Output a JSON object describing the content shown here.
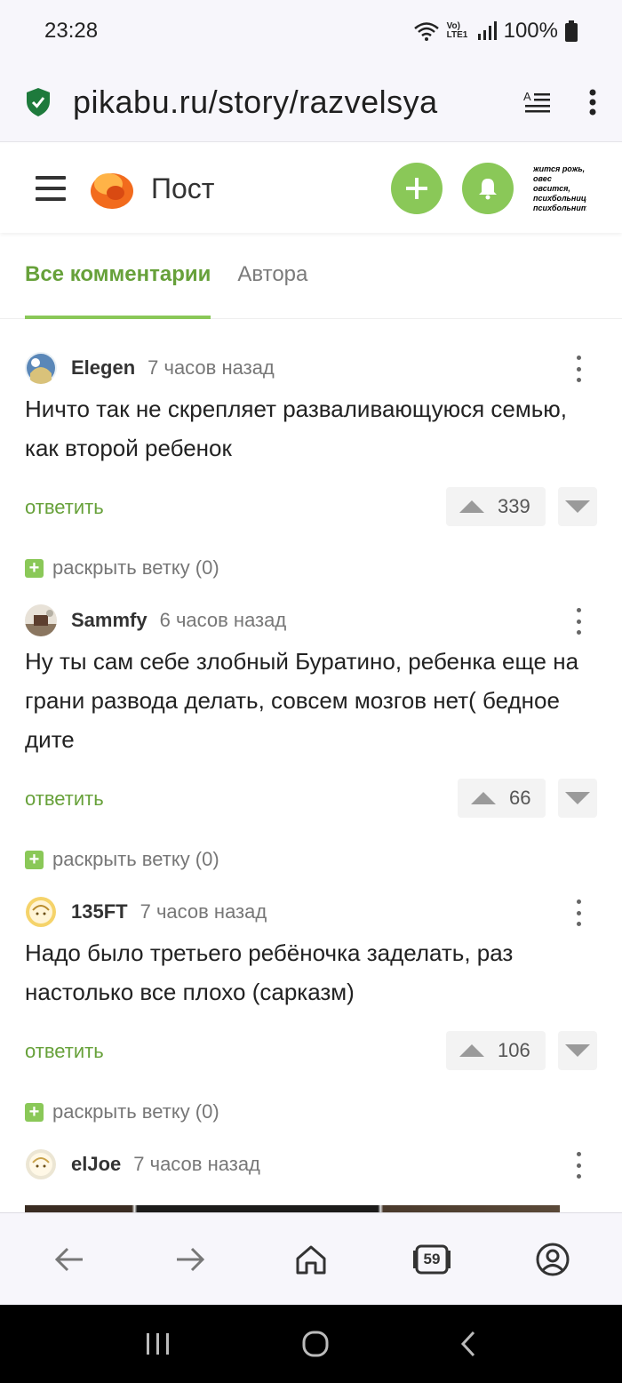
{
  "status_bar": {
    "time": "23:28",
    "network": "Vo) LTE1",
    "battery": "100%"
  },
  "browser": {
    "url": "pikabu.ru/story/razvelsya",
    "tab_count": "59"
  },
  "header": {
    "title": "Пост",
    "thumbnail_lines": [
      "жится рожь,",
      "овес овсится,",
      "психбольница",
      "психбольнит"
    ]
  },
  "tabs": [
    {
      "label": "Все комментарии",
      "active": true
    },
    {
      "label": "Автора",
      "active": false
    }
  ],
  "comments": [
    {
      "user": "Elegen",
      "time": "7 часов назад",
      "text": "Ничто так не скрепляет разваливающуюся семью, как второй ребенок",
      "rating": "339",
      "reply_label": "ответить",
      "expand_label": "раскрыть ветку (0)"
    },
    {
      "user": "Sammfy",
      "time": "6 часов назад",
      "text": "Ну ты сам себе злобный Буратино, ребенка еще на грани развода делать, совсем мозгов нет( бедное дите",
      "rating": "66",
      "reply_label": "ответить",
      "expand_label": "раскрыть ветку (0)"
    },
    {
      "user": "135FT",
      "time": "7 часов назад",
      "text": "Надо было третьего ребёночка заделать, раз настолько все плохо (сарказм)",
      "rating": "106",
      "reply_label": "ответить",
      "expand_label": "раскрыть ветку (0)"
    },
    {
      "user": "elJoe",
      "time": "7 часов назад"
    }
  ],
  "colors": {
    "accent": "#8ac858",
    "accent_text": "#67a13a",
    "browser_bg": "#f7f6fb"
  },
  "icons": {
    "menu": "hamburger-icon",
    "logo": "pikabu-logo-icon",
    "add": "plus-icon",
    "notifications": "bell-icon",
    "security": "shield-check-icon",
    "reader": "reader-mode-icon",
    "back": "arrow-left-icon",
    "forward": "arrow-right-icon",
    "home": "home-icon",
    "tabs": "tabs-icon",
    "account": "account-icon"
  }
}
